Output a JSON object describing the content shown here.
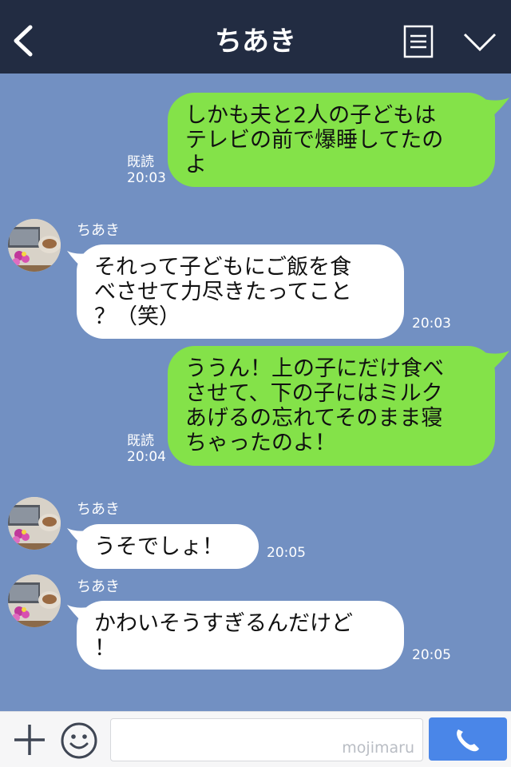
{
  "header": {
    "title": "ちあき",
    "icons": {
      "back": "chevron-left-icon",
      "menu": "note-list-icon",
      "expand": "chevron-down-icon"
    }
  },
  "messages": [
    {
      "side": "out",
      "text": "しかも夫と2人の子どもは\nテレビの前で爆睡してたの\nよ",
      "read": "既読",
      "time": "20:03"
    },
    {
      "side": "in",
      "sender": "ちあき",
      "text": "それって子どもにご飯を食\nべさせて力尽きたってこと\n？（笑）",
      "time": "20:03"
    },
    {
      "side": "out",
      "text": "ううん！上の子にだけ食べ\nさせて、下の子にはミルク\nあげるの忘れてそのまま寝\nちゃったのよ！",
      "read": "既読",
      "time": "20:04"
    },
    {
      "side": "in",
      "sender": "ちあき",
      "text": "うそでしょ！",
      "time": "20:05"
    },
    {
      "side": "in",
      "sender": "ちあき",
      "text": "かわいそうすぎるんだけど\n！",
      "time": "20:05"
    }
  ],
  "input_bar": {
    "value": "",
    "watermark": "mojimaru",
    "icons": {
      "plus": "plus-icon",
      "emoji": "smiley-icon",
      "call": "phone-icon"
    }
  },
  "colors": {
    "header_bg": "#222c42",
    "chat_bg": "#7290c2",
    "outgoing_bubble": "#84e249",
    "incoming_bubble": "#ffffff",
    "call_button": "#4a86e8"
  }
}
